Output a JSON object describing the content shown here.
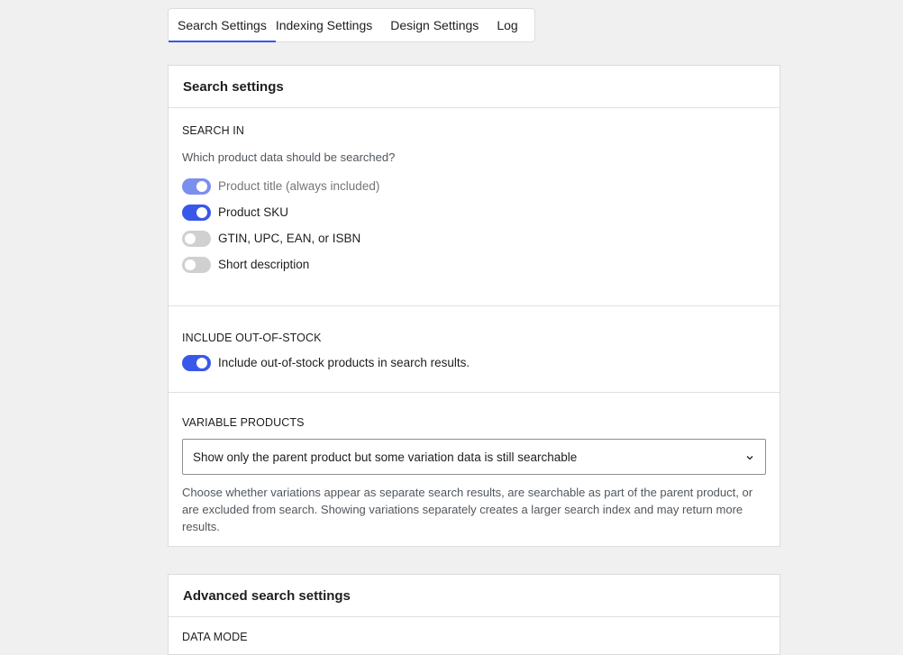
{
  "tabs": [
    {
      "label": "Search Settings",
      "active": true
    },
    {
      "label": "Indexing Settings",
      "active": false
    },
    {
      "label": "Design Settings",
      "active": false
    },
    {
      "label": "Log",
      "active": false
    }
  ],
  "search_settings": {
    "title": "Search settings",
    "search_in": {
      "heading": "SEARCH IN",
      "help": "Which product data should be searched?",
      "options": [
        {
          "label": "Product title (always included)",
          "state": "on-disabled"
        },
        {
          "label": "Product SKU",
          "state": "on"
        },
        {
          "label": "GTIN, UPC, EAN, or ISBN",
          "state": "off"
        },
        {
          "label": "Short description",
          "state": "off"
        }
      ]
    },
    "out_of_stock": {
      "heading": "INCLUDE OUT-OF-STOCK",
      "option": {
        "label": "Include out-of-stock products in search results.",
        "state": "on"
      }
    },
    "variable_products": {
      "heading": "VARIABLE PRODUCTS",
      "selected": "Show only the parent product but some variation data is still searchable",
      "help": "Choose whether variations appear as separate search results, are searchable as part of the parent product, or are excluded from search. Showing variations separately creates a larger search index and may return more results."
    }
  },
  "advanced": {
    "title": "Advanced search settings",
    "data_mode_heading": "DATA MODE"
  },
  "colors": {
    "accent": "#3858e9",
    "accent_disabled": "#7b8fed",
    "background": "#f0f0f1"
  }
}
